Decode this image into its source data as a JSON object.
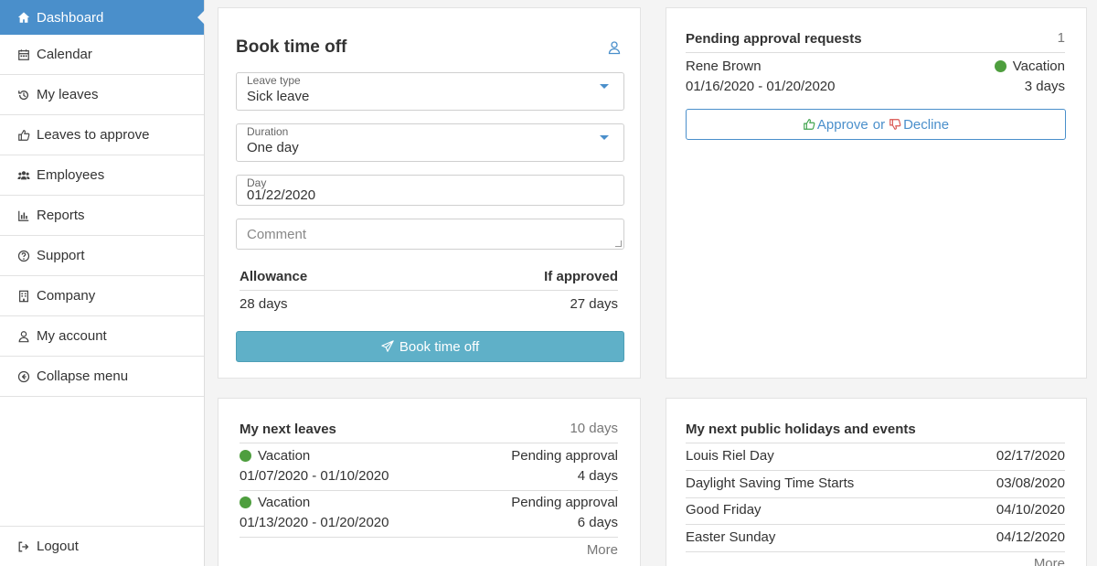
{
  "sidebar": {
    "items": [
      {
        "label": "Dashboard",
        "icon": "home-icon"
      },
      {
        "label": "Calendar",
        "icon": "calendar-icon"
      },
      {
        "label": "My leaves",
        "icon": "history-icon"
      },
      {
        "label": "Leaves to approve",
        "icon": "thumbs-up-icon"
      },
      {
        "label": "Employees",
        "icon": "users-icon"
      },
      {
        "label": "Reports",
        "icon": "chart-icon"
      },
      {
        "label": "Support",
        "icon": "question-icon"
      },
      {
        "label": "Company",
        "icon": "building-icon"
      },
      {
        "label": "My account",
        "icon": "user-icon"
      },
      {
        "label": "Collapse menu",
        "icon": "circle-arrow-left-icon"
      }
    ],
    "logout_label": "Logout",
    "active_color": "#4a8fcb"
  },
  "book": {
    "title": "Book time off",
    "leave_type": {
      "label": "Leave type",
      "value": "Sick leave"
    },
    "duration": {
      "label": "Duration",
      "value": "One day"
    },
    "day": {
      "label": "Day",
      "value": "01/22/2020"
    },
    "comment_placeholder": "Comment",
    "allowance_label": "Allowance",
    "if_approved_label": "If approved",
    "allowance_value": "28 days",
    "if_approved_value": "27 days",
    "button_label": "Book time off",
    "button_color": "#5fb0c8"
  },
  "pending": {
    "title": "Pending approval requests",
    "count": "1",
    "request": {
      "name": "Rene Brown",
      "dates": "01/16/2020 - 01/20/2020",
      "type": "Vacation",
      "days": "3 days",
      "dot_color": "#4e9e3e"
    },
    "approve_label": "Approve",
    "or_label": "or",
    "decline_label": "Decline"
  },
  "next_leaves": {
    "title": "My next leaves",
    "total": "10 days",
    "items": [
      {
        "type": "Vacation",
        "dates": "01/07/2020 - 01/10/2020",
        "status": "Pending approval",
        "days": "4 days"
      },
      {
        "type": "Vacation",
        "dates": "01/13/2020 - 01/20/2020",
        "status": "Pending approval",
        "days": "6 days"
      }
    ],
    "more_label": "More"
  },
  "holidays": {
    "title": "My next public holidays and events",
    "items": [
      {
        "name": "Louis Riel Day",
        "date": "02/17/2020"
      },
      {
        "name": "Daylight Saving Time Starts",
        "date": "03/08/2020"
      },
      {
        "name": "Good Friday",
        "date": "04/10/2020"
      },
      {
        "name": "Easter Sunday",
        "date": "04/12/2020"
      }
    ],
    "more_label": "More"
  }
}
